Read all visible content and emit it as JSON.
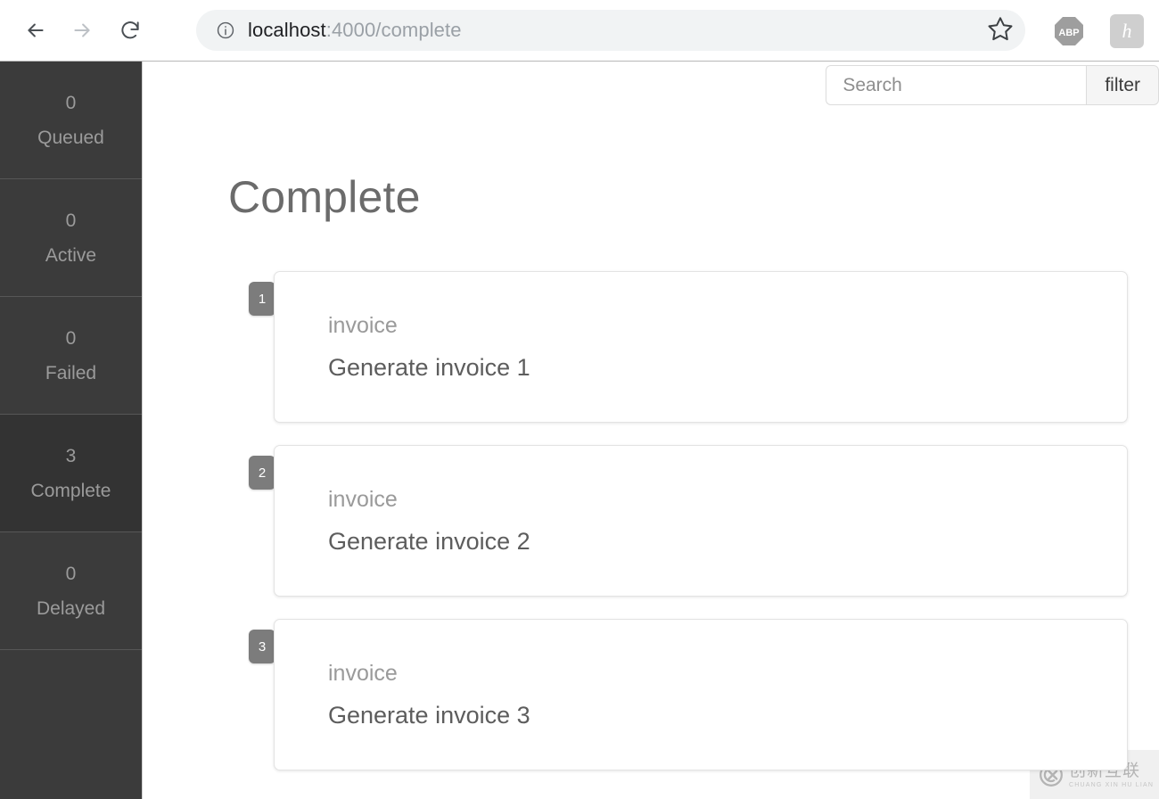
{
  "browser": {
    "back_icon": "arrow-left-icon",
    "forward_icon": "arrow-right-icon",
    "reload_icon": "reload-icon",
    "site_info_icon": "info-circle-icon",
    "url_host": "localhost",
    "url_path": ":4000/complete",
    "bookmark_icon": "star-icon",
    "extensions": [
      {
        "name": "adblock-plus",
        "label": "ABP"
      },
      {
        "name": "honey",
        "label": "h"
      }
    ]
  },
  "sidebar": {
    "items": [
      {
        "count": "0",
        "label": "Queued",
        "active": false
      },
      {
        "count": "0",
        "label": "Active",
        "active": false
      },
      {
        "count": "0",
        "label": "Failed",
        "active": false
      },
      {
        "count": "3",
        "label": "Complete",
        "active": true
      },
      {
        "count": "0",
        "label": "Delayed",
        "active": false
      }
    ]
  },
  "toolbar": {
    "search_placeholder": "Search",
    "search_value": "",
    "filter_label": "filter"
  },
  "main": {
    "title": "Complete",
    "jobs": [
      {
        "badge": "1",
        "job_class": "invoice",
        "job_name": "Generate invoice 1"
      },
      {
        "badge": "2",
        "job_class": "invoice",
        "job_name": "Generate invoice 2"
      },
      {
        "badge": "3",
        "job_class": "invoice",
        "job_name": "Generate invoice 3"
      }
    ]
  },
  "watermark": {
    "logo_icon": "cx-logo-icon",
    "cn_text": "创新互联",
    "pinyin_text": "CHUANG XIN HU LIAN"
  },
  "colors": {
    "sidebar_bg": "#3b3b3b",
    "sidebar_active_bg": "#333333",
    "badge_bg": "#7c7c7c",
    "title_text": "#6b6b6b",
    "card_border": "#e3e3e3"
  }
}
